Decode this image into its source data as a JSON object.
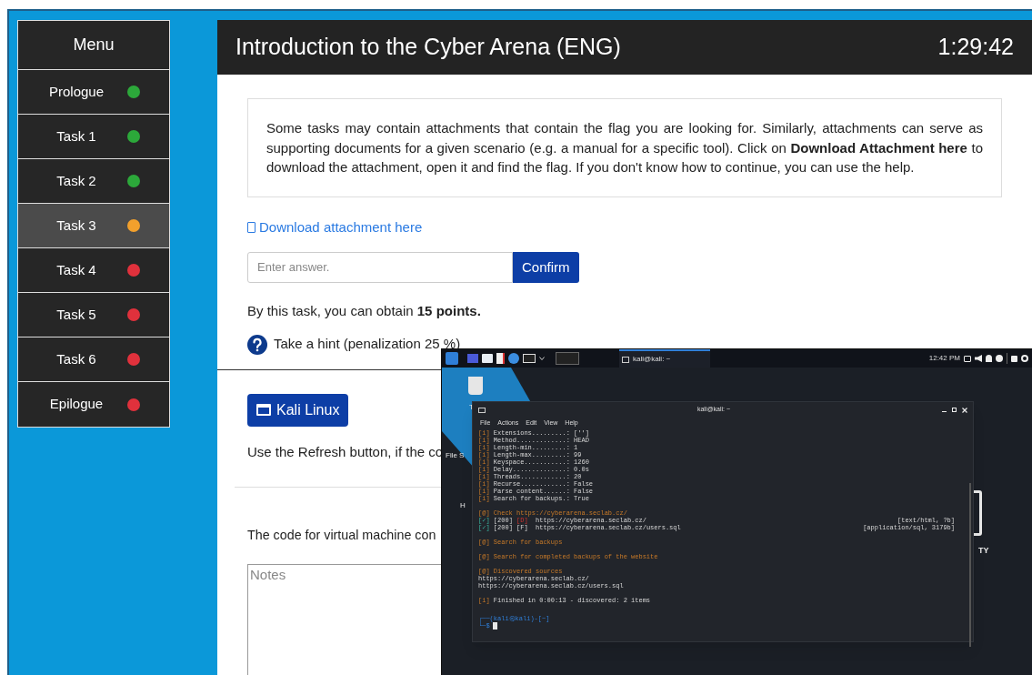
{
  "menu": {
    "title": "Menu",
    "items": [
      {
        "label": "Prologue",
        "selected": false,
        "color": "#2ca83a"
      },
      {
        "label": "Task 1",
        "selected": false,
        "color": "#2ca83a"
      },
      {
        "label": "Task 2",
        "selected": false,
        "color": "#2ca83a"
      },
      {
        "label": "Task 3",
        "selected": true,
        "color": "#f2a02c"
      },
      {
        "label": "Task 4",
        "selected": false,
        "color": "#e0313c"
      },
      {
        "label": "Task 5",
        "selected": false,
        "color": "#e0313c"
      },
      {
        "label": "Task 6",
        "selected": false,
        "color": "#e0313c"
      },
      {
        "label": "Epilogue",
        "selected": false,
        "color": "#e0313c"
      }
    ]
  },
  "header": {
    "title": "Introduction to the Cyber Arena (ENG)",
    "timer": "1:29:42"
  },
  "task": {
    "description": "Some tasks may contain attachments that contain the flag you are looking for. Similarly, attachments can serve as supporting documents for a given scenario (e.g. a manual for a specific tool). Click on **Download Attachment here** to download the attachment, open it and find the flag. If you don't know how to continue, you can use the help.",
    "attachment_link": "Download attachment here",
    "answer": {
      "placeholder": "Enter answer.",
      "button": "Confirm"
    },
    "points": "By this task, you can obtain **15 points.**",
    "hint": "Take a hint (penalization 25 %)"
  },
  "vm": {
    "button": "Kali Linux",
    "refresh_note": "Use the Refresh button, if the co",
    "code_note": "The code for virtual machine con",
    "notes": {
      "placeholder": "Notes"
    }
  },
  "kali": {
    "taskbar": {
      "window_button": "kali@kali: ~",
      "clock": "12:42 PM"
    },
    "desktop_icons": [
      {
        "label": "T"
      },
      {
        "label": "File S"
      },
      {
        "label": "H"
      }
    ],
    "wallpaper_text": "TY",
    "terminal": {
      "title": "kali@kali: ~",
      "menu": [
        "File",
        "Actions",
        "Edit",
        "View",
        "Help"
      ],
      "lines": [
        {
          "kind": "info",
          "marker": "[i]",
          "text": "Extensions.........: ['']"
        },
        {
          "kind": "info",
          "marker": "[i]",
          "text": "Method.............: HEAD"
        },
        {
          "kind": "info",
          "marker": "[i]",
          "text": "Length-min.........: 1"
        },
        {
          "kind": "info",
          "marker": "[i]",
          "text": "Length-max.........: 99"
        },
        {
          "kind": "info",
          "marker": "[i]",
          "text": "Keyspace...........: 1260"
        },
        {
          "kind": "info",
          "marker": "[i]",
          "text": "Delay..............: 0.0s"
        },
        {
          "kind": "info",
          "marker": "[i]",
          "text": "Threads............: 20"
        },
        {
          "kind": "info",
          "marker": "[i]",
          "text": "Recurse............: False"
        },
        {
          "kind": "info",
          "marker": "[i]",
          "text": "Parse content......: False"
        },
        {
          "kind": "info",
          "marker": "[i]",
          "text": "Search for backups.: True"
        },
        {
          "kind": "blank"
        },
        {
          "kind": "section",
          "marker": "[@]",
          "text": "Check https://cyberarena.seclab.cz/"
        },
        {
          "kind": "found_dir",
          "marker": "[✓]",
          "status": "[200]",
          "tag": "[D]",
          "text": "https://cyberarena.seclab.cz/",
          "detail": "[text/html, ?b]"
        },
        {
          "kind": "found_file",
          "marker": "[✓]",
          "status": "[200]",
          "tag": "[F]",
          "text": "https://cyberarena.seclab.cz/users.sql",
          "detail": "[application/sql, 3179b]"
        },
        {
          "kind": "blank"
        },
        {
          "kind": "section",
          "marker": "[@]",
          "text": "Search for backups"
        },
        {
          "kind": "blank"
        },
        {
          "kind": "section",
          "marker": "[@]",
          "text": "Search for completed backups of the website"
        },
        {
          "kind": "blank"
        },
        {
          "kind": "section",
          "marker": "[@]",
          "text": "Discovered sources"
        },
        {
          "kind": "plain",
          "text": "https://cyberarena.seclab.cz/"
        },
        {
          "kind": "plain",
          "text": "https://cyberarena.seclab.cz/users.sql"
        },
        {
          "kind": "blank"
        },
        {
          "kind": "info",
          "marker": "[i]",
          "text": "Finished in 0:00:13 - discovered: 2 items"
        },
        {
          "kind": "blank"
        },
        {
          "kind": "prompt",
          "text": "┌──(kali㉿kali)-[~]"
        },
        {
          "kind": "cursor",
          "text": "└─$"
        }
      ]
    }
  }
}
